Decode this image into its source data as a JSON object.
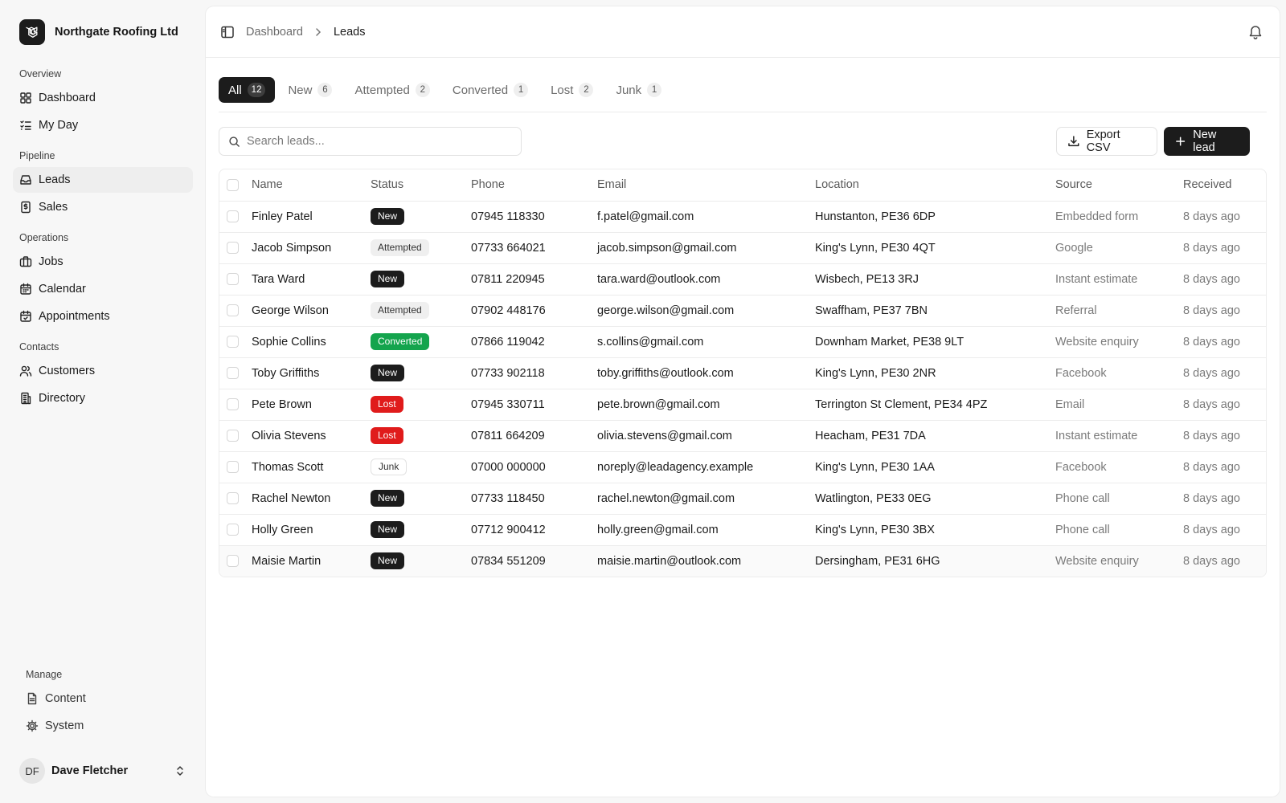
{
  "brand": {
    "name": "Northgate Roofing Ltd",
    "logo_icon": "laravel-logo-icon"
  },
  "sidebar": {
    "groups": [
      {
        "label": "Overview",
        "items": [
          {
            "label": "Dashboard",
            "icon": "grid-icon"
          },
          {
            "label": "My Day",
            "icon": "list-checks-icon"
          }
        ]
      },
      {
        "label": "Pipeline",
        "items": [
          {
            "label": "Leads",
            "icon": "inbox-icon",
            "active": true
          },
          {
            "label": "Sales",
            "icon": "receipt-icon"
          }
        ]
      },
      {
        "label": "Operations",
        "items": [
          {
            "label": "Jobs",
            "icon": "briefcase-icon"
          },
          {
            "label": "Calendar",
            "icon": "calendar-icon"
          },
          {
            "label": "Appointments",
            "icon": "calendar-check-icon"
          }
        ]
      },
      {
        "label": "Contacts",
        "items": [
          {
            "label": "Customers",
            "icon": "users-icon"
          },
          {
            "label": "Directory",
            "icon": "building-icon"
          }
        ]
      }
    ],
    "manage": {
      "label": "Manage",
      "items": [
        {
          "label": "Content",
          "icon": "file-text-icon"
        },
        {
          "label": "System",
          "icon": "gear-icon"
        }
      ]
    },
    "user": {
      "initials": "DF",
      "name": "Dave Fletcher"
    }
  },
  "header": {
    "breadcrumb": [
      "Dashboard",
      "Leads"
    ]
  },
  "tabs": [
    {
      "label": "All",
      "count": "12",
      "active": true
    },
    {
      "label": "New",
      "count": "6"
    },
    {
      "label": "Attempted",
      "count": "2"
    },
    {
      "label": "Converted",
      "count": "1"
    },
    {
      "label": "Lost",
      "count": "2"
    },
    {
      "label": "Junk",
      "count": "1"
    }
  ],
  "search": {
    "placeholder": "Search leads...",
    "value": ""
  },
  "actions": {
    "export_label": "Export CSV",
    "new_label": "New lead"
  },
  "table": {
    "columns": [
      "Name",
      "Status",
      "Phone",
      "Email",
      "Location",
      "Source",
      "Received"
    ],
    "rows": [
      {
        "name": "Finley Patel",
        "status": "New",
        "phone": "07945 118330",
        "email": "f.patel@gmail.com",
        "location": "Hunstanton, PE36 6DP",
        "source": "Embedded form",
        "received": "8 days ago"
      },
      {
        "name": "Jacob Simpson",
        "status": "Attempted",
        "phone": "07733 664021",
        "email": "jacob.simpson@gmail.com",
        "location": "King's Lynn, PE30 4QT",
        "source": "Google",
        "received": "8 days ago"
      },
      {
        "name": "Tara Ward",
        "status": "New",
        "phone": "07811 220945",
        "email": "tara.ward@outlook.com",
        "location": "Wisbech, PE13 3RJ",
        "source": "Instant estimate",
        "received": "8 days ago"
      },
      {
        "name": "George Wilson",
        "status": "Attempted",
        "phone": "07902 448176",
        "email": "george.wilson@gmail.com",
        "location": "Swaffham, PE37 7BN",
        "source": "Referral",
        "received": "8 days ago"
      },
      {
        "name": "Sophie Collins",
        "status": "Converted",
        "phone": "07866 119042",
        "email": "s.collins@gmail.com",
        "location": "Downham Market, PE38 9LT",
        "source": "Website enquiry",
        "received": "8 days ago"
      },
      {
        "name": "Toby Griffiths",
        "status": "New",
        "phone": "07733 902118",
        "email": "toby.griffiths@outlook.com",
        "location": "King's Lynn, PE30 2NR",
        "source": "Facebook",
        "received": "8 days ago"
      },
      {
        "name": "Pete Brown",
        "status": "Lost",
        "phone": "07945 330711",
        "email": "pete.brown@gmail.com",
        "location": "Terrington St Clement, PE34 4PZ",
        "source": "Email",
        "received": "8 days ago"
      },
      {
        "name": "Olivia Stevens",
        "status": "Lost",
        "phone": "07811 664209",
        "email": "olivia.stevens@gmail.com",
        "location": "Heacham, PE31 7DA",
        "source": "Instant estimate",
        "received": "8 days ago"
      },
      {
        "name": "Thomas Scott",
        "status": "Junk",
        "phone": "07000 000000",
        "email": "noreply@leadagency.example",
        "location": "King's Lynn, PE30 1AA",
        "source": "Facebook",
        "received": "8 days ago"
      },
      {
        "name": "Rachel Newton",
        "status": "New",
        "phone": "07733 118450",
        "email": "rachel.newton@gmail.com",
        "location": "Watlington, PE33 0EG",
        "source": "Phone call",
        "received": "8 days ago"
      },
      {
        "name": "Holly Green",
        "status": "New",
        "phone": "07712 900412",
        "email": "holly.green@gmail.com",
        "location": "King's Lynn, PE30 3BX",
        "source": "Phone call",
        "received": "8 days ago"
      },
      {
        "name": "Maisie Martin",
        "status": "New",
        "phone": "07834 551209",
        "email": "maisie.martin@outlook.com",
        "location": "Dersingham, PE31 6HG",
        "source": "Website enquiry",
        "received": "8 days ago"
      }
    ]
  },
  "colors": {
    "accent": "#1c1c1c",
    "status_new": "#1c1c1c",
    "status_converted": "#14a44d",
    "status_lost": "#e01b1b",
    "status_attempted": "#efefef"
  }
}
